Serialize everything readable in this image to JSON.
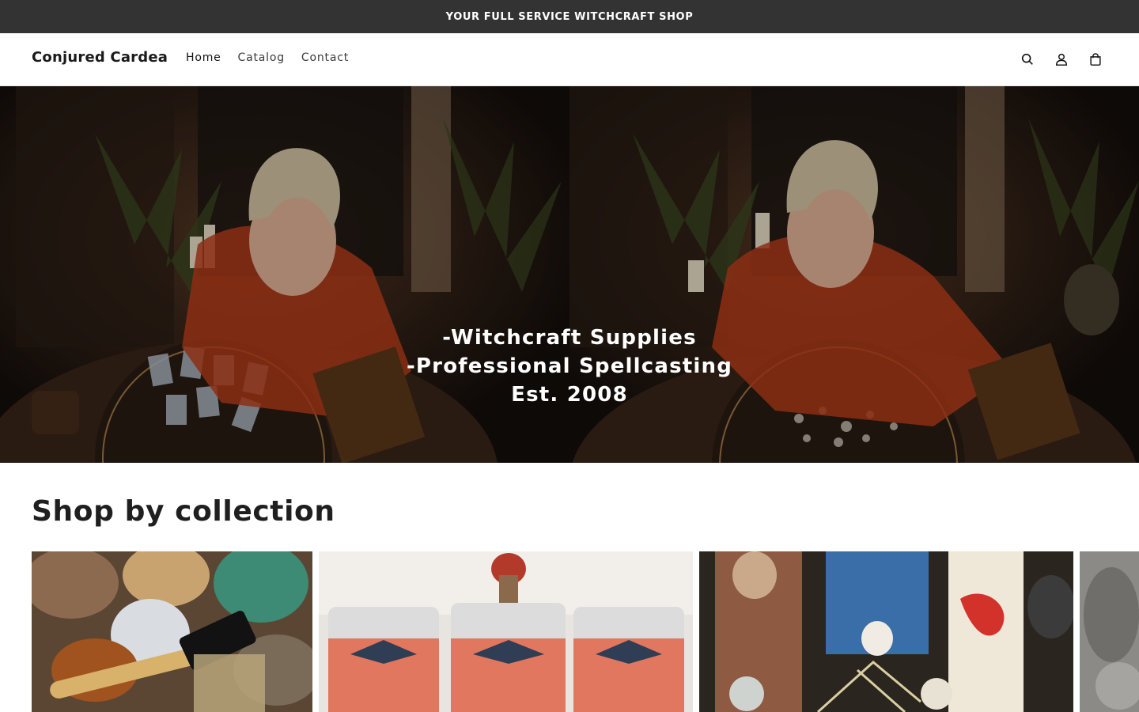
{
  "announcement": {
    "text": "YOUR FULL SERVICE WITCHCRAFT SHOP"
  },
  "header": {
    "logo": "Conjured Cardea",
    "nav": [
      {
        "label": "Home",
        "active": true
      },
      {
        "label": "Catalog",
        "active": false
      },
      {
        "label": "Contact",
        "active": false
      }
    ],
    "icons": [
      "search-icon",
      "account-icon",
      "cart-icon"
    ]
  },
  "hero": {
    "lines": [
      "-Witchcraft Supplies",
      "-Professional Spellcasting",
      "Est. 2008"
    ]
  },
  "collections": {
    "title": "Shop by collection",
    "cards": [
      {
        "image": "crystals-and-herbs-photo"
      },
      {
        "image": "spell-candles-photo"
      },
      {
        "image": "saint-statues-altar-photo"
      },
      {
        "image": "grey-stone-photo"
      }
    ]
  },
  "colors": {
    "announcement_bg": "#333333",
    "text": "#121212",
    "background": "#ffffff"
  }
}
